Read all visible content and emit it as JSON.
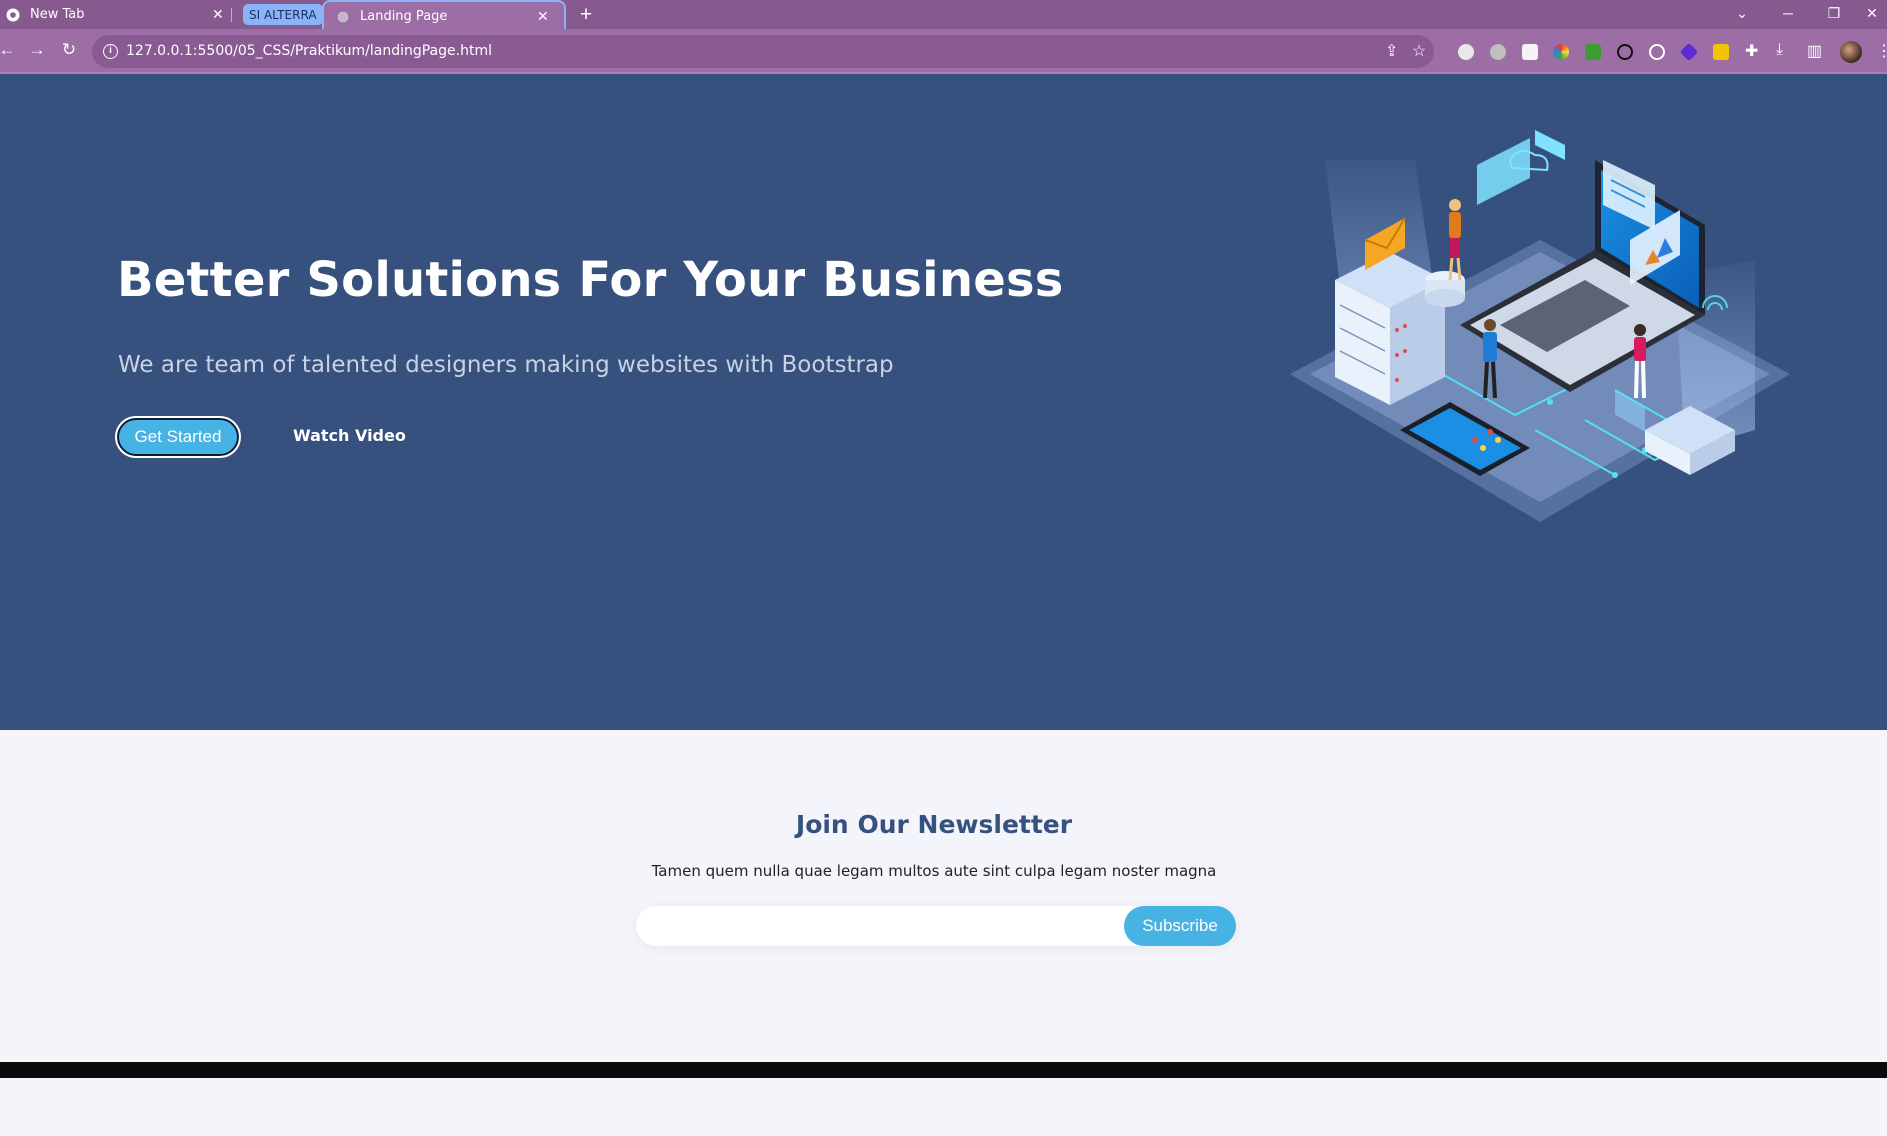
{
  "browser": {
    "tabs": [
      {
        "title": "New Tab",
        "active": false
      },
      {
        "title": "Landing Page",
        "active": true
      }
    ],
    "tab_group_label": "SI ALTERRA",
    "url": "127.0.0.1:5500/05_CSS/Praktikum/landingPage.html",
    "accent_color": "#9d6da6"
  },
  "hero": {
    "title": "Better Solutions For Your Business",
    "subtitle": "We are team of talented designers making websites with Bootstrap",
    "primary_button": "Get Started",
    "secondary_button": "Watch Video",
    "background_color": "#37517e",
    "illustration": "isometric-tech-illustration"
  },
  "newsletter": {
    "title": "Join Our Newsletter",
    "description": "Tamen quem nulla quae legam multos aute sint culpa legam noster magna",
    "input_value": "",
    "button": "Subscribe",
    "accent_color": "#47b2e4"
  }
}
